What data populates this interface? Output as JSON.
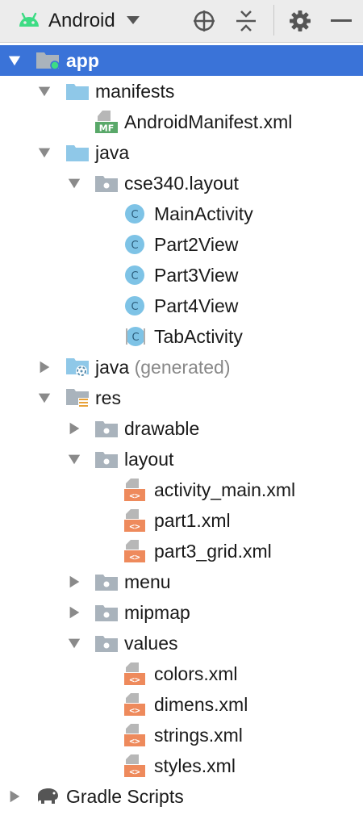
{
  "toolbar": {
    "view_label": "Android",
    "buttons": [
      "locate-icon",
      "collapse-all-icon",
      "gear-icon",
      "minimize-icon"
    ]
  },
  "colors": {
    "selection": "#3a73d8",
    "folder": "#8fc8e8",
    "class_icon": "#7ec3e6",
    "xml_icon": "#ee8a5c",
    "manifest_badge": "#59a869",
    "android": "#3ddc84"
  },
  "tree": {
    "app": "app",
    "manifests": "manifests",
    "android_manifest": "AndroidManifest.xml",
    "manifest_badge": "MF",
    "java": "java",
    "cse340_layout": "cse340.layout",
    "main_activity": "MainActivity",
    "part2_view": "Part2View",
    "part3_view": "Part3View",
    "part4_view": "Part4View",
    "tab_activity": "TabActivity",
    "class_letter": "C",
    "java_generated": "java",
    "java_generated_suffix": "(generated)",
    "res": "res",
    "drawable": "drawable",
    "layout": "layout",
    "activity_main_xml": "activity_main.xml",
    "part1_xml": "part1.xml",
    "part3_grid_xml": "part3_grid.xml",
    "menu": "menu",
    "mipmap": "mipmap",
    "values": "values",
    "colors_xml": "colors.xml",
    "dimens_xml": "dimens.xml",
    "strings_xml": "strings.xml",
    "styles_xml": "styles.xml",
    "gradle_scripts": "Gradle Scripts"
  }
}
